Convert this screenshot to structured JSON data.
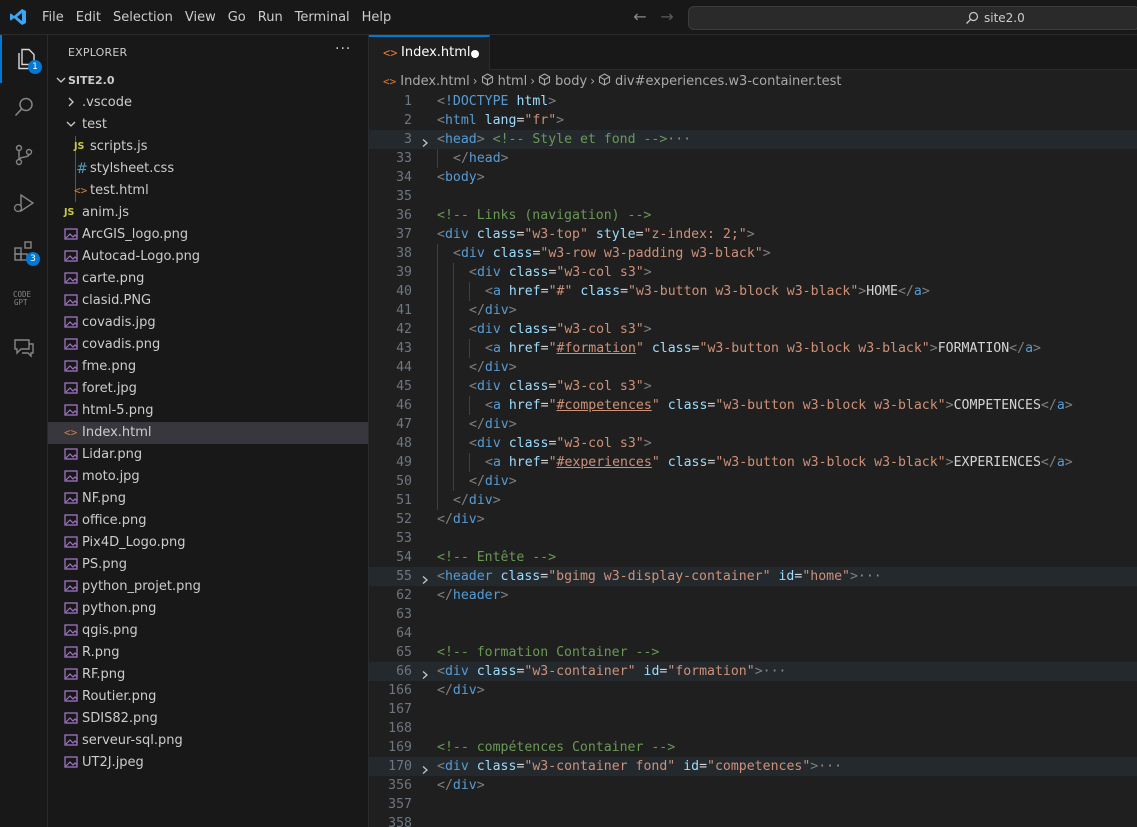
{
  "menu": [
    "File",
    "Edit",
    "Selection",
    "View",
    "Go",
    "Run",
    "Terminal",
    "Help"
  ],
  "command_center": {
    "label": "site2.0"
  },
  "activity_badges": {
    "explorer": "1",
    "extensions": "3"
  },
  "sidebar": {
    "title": "EXPLORER",
    "more": "···",
    "folder": "SITE2.0",
    "items": [
      {
        "label": ".vscode",
        "type": "folder-closed"
      },
      {
        "label": "test",
        "type": "folder-open"
      },
      {
        "label": "scripts.js",
        "type": "js"
      },
      {
        "label": "stylsheet.css",
        "type": "css"
      },
      {
        "label": "test.html",
        "type": "html"
      },
      {
        "label": "anim.js",
        "type": "js"
      },
      {
        "label": "ArcGIS_logo.png",
        "type": "image"
      },
      {
        "label": "Autocad-Logo.png",
        "type": "image"
      },
      {
        "label": "carte.png",
        "type": "image"
      },
      {
        "label": "clasid.PNG",
        "type": "image"
      },
      {
        "label": "covadis.jpg",
        "type": "image"
      },
      {
        "label": "covadis.png",
        "type": "image"
      },
      {
        "label": "fme.png",
        "type": "image"
      },
      {
        "label": "foret.jpg",
        "type": "image"
      },
      {
        "label": "html-5.png",
        "type": "image"
      },
      {
        "label": "Index.html",
        "type": "html"
      },
      {
        "label": "Lidar.png",
        "type": "image"
      },
      {
        "label": "moto.jpg",
        "type": "image"
      },
      {
        "label": "NF.png",
        "type": "image"
      },
      {
        "label": "office.png",
        "type": "image"
      },
      {
        "label": "Pix4D_Logo.png",
        "type": "image"
      },
      {
        "label": "PS.png",
        "type": "image"
      },
      {
        "label": "python_projet.png",
        "type": "image"
      },
      {
        "label": "python.png",
        "type": "image"
      },
      {
        "label": "qgis.png",
        "type": "image"
      },
      {
        "label": "R.png",
        "type": "image"
      },
      {
        "label": "RF.png",
        "type": "image"
      },
      {
        "label": "Routier.png",
        "type": "image"
      },
      {
        "label": "SDIS82.png",
        "type": "image"
      },
      {
        "label": "serveur-sql.png",
        "type": "image"
      },
      {
        "label": "UT2J.jpeg",
        "type": "image"
      }
    ]
  },
  "editor": {
    "tab": {
      "label": "Index.html"
    },
    "breadcrumbs": [
      "Index.html",
      "html",
      "body",
      "div#experiences.w3-container.test"
    ],
    "lines": [
      {
        "n": "1",
        "indent": 0,
        "tokens": [
          [
            "t",
            "<"
          ],
          [
            "tn",
            "!DOCTYPE"
          ],
          [
            "tx",
            " "
          ],
          [
            "an",
            "html"
          ],
          [
            "t",
            ">"
          ]
        ]
      },
      {
        "n": "2",
        "indent": 0,
        "tokens": [
          [
            "t",
            "<"
          ],
          [
            "tn",
            "html"
          ],
          [
            "tx",
            " "
          ],
          [
            "an",
            "lang"
          ],
          [
            "tx",
            "="
          ],
          [
            "av",
            "\"fr\""
          ],
          [
            "t",
            ">"
          ]
        ]
      },
      {
        "n": "3",
        "indent": 0,
        "fold": true,
        "hl": true,
        "tokens": [
          [
            "t",
            "<"
          ],
          [
            "tn",
            "head"
          ],
          [
            "t",
            ">"
          ],
          [
            "tx",
            " "
          ],
          [
            "cm",
            "<!-- Style et fond -->"
          ],
          [
            "ell",
            "···"
          ]
        ]
      },
      {
        "n": "33",
        "indent": 1,
        "tokens": [
          [
            "t",
            "</"
          ],
          [
            "tn",
            "head"
          ],
          [
            "t",
            ">"
          ]
        ]
      },
      {
        "n": "34",
        "indent": 0,
        "tokens": [
          [
            "t",
            "<"
          ],
          [
            "tn",
            "body"
          ],
          [
            "t",
            ">"
          ]
        ]
      },
      {
        "n": "35",
        "indent": 0,
        "tokens": []
      },
      {
        "n": "36",
        "indent": 0,
        "tokens": [
          [
            "cm",
            "<!-- Links (navigation) -->"
          ]
        ]
      },
      {
        "n": "37",
        "indent": 0,
        "tokens": [
          [
            "t",
            "<"
          ],
          [
            "tn",
            "div"
          ],
          [
            "tx",
            " "
          ],
          [
            "an",
            "class"
          ],
          [
            "tx",
            "="
          ],
          [
            "av",
            "\"w3-top\""
          ],
          [
            "tx",
            " "
          ],
          [
            "an",
            "style"
          ],
          [
            "tx",
            "="
          ],
          [
            "av",
            "\"z-index: 2;\""
          ],
          [
            "t",
            ">"
          ]
        ]
      },
      {
        "n": "38",
        "indent": 1,
        "tokens": [
          [
            "t",
            "<"
          ],
          [
            "tn",
            "div"
          ],
          [
            "tx",
            " "
          ],
          [
            "an",
            "class"
          ],
          [
            "tx",
            "="
          ],
          [
            "av",
            "\"w3-row w3-padding w3-black\""
          ],
          [
            "t",
            ">"
          ]
        ]
      },
      {
        "n": "39",
        "indent": 2,
        "tokens": [
          [
            "t",
            "<"
          ],
          [
            "tn",
            "div"
          ],
          [
            "tx",
            " "
          ],
          [
            "an",
            "class"
          ],
          [
            "tx",
            "="
          ],
          [
            "av",
            "\"w3-col s3\""
          ],
          [
            "t",
            ">"
          ]
        ]
      },
      {
        "n": "40",
        "indent": 3,
        "tokens": [
          [
            "t",
            "<"
          ],
          [
            "tn",
            "a"
          ],
          [
            "tx",
            " "
          ],
          [
            "an",
            "href"
          ],
          [
            "tx",
            "="
          ],
          [
            "av",
            "\"#\""
          ],
          [
            "tx",
            " "
          ],
          [
            "an",
            "class"
          ],
          [
            "tx",
            "="
          ],
          [
            "av",
            "\"w3-button w3-block w3-black\""
          ],
          [
            "t",
            ">"
          ],
          [
            "tx",
            "HOME"
          ],
          [
            "t",
            "</"
          ],
          [
            "tn",
            "a"
          ],
          [
            "t",
            ">"
          ]
        ]
      },
      {
        "n": "41",
        "indent": 2,
        "tokens": [
          [
            "t",
            "</"
          ],
          [
            "tn",
            "div"
          ],
          [
            "t",
            ">"
          ]
        ]
      },
      {
        "n": "42",
        "indent": 2,
        "tokens": [
          [
            "t",
            "<"
          ],
          [
            "tn",
            "div"
          ],
          [
            "tx",
            " "
          ],
          [
            "an",
            "class"
          ],
          [
            "tx",
            "="
          ],
          [
            "av",
            "\"w3-col s3\""
          ],
          [
            "t",
            ">"
          ]
        ]
      },
      {
        "n": "43",
        "indent": 3,
        "tokens": [
          [
            "t",
            "<"
          ],
          [
            "tn",
            "a"
          ],
          [
            "tx",
            " "
          ],
          [
            "an",
            "href"
          ],
          [
            "tx",
            "="
          ],
          [
            "av",
            "\""
          ],
          [
            "lnk",
            "#formation"
          ],
          [
            "av",
            "\""
          ],
          [
            "tx",
            " "
          ],
          [
            "an",
            "class"
          ],
          [
            "tx",
            "="
          ],
          [
            "av",
            "\"w3-button w3-block w3-black\""
          ],
          [
            "t",
            ">"
          ],
          [
            "tx",
            "FORMATION"
          ],
          [
            "t",
            "</"
          ],
          [
            "tn",
            "a"
          ],
          [
            "t",
            ">"
          ]
        ]
      },
      {
        "n": "44",
        "indent": 2,
        "tokens": [
          [
            "t",
            "</"
          ],
          [
            "tn",
            "div"
          ],
          [
            "t",
            ">"
          ]
        ]
      },
      {
        "n": "45",
        "indent": 2,
        "tokens": [
          [
            "t",
            "<"
          ],
          [
            "tn",
            "div"
          ],
          [
            "tx",
            " "
          ],
          [
            "an",
            "class"
          ],
          [
            "tx",
            "="
          ],
          [
            "av",
            "\"w3-col s3\""
          ],
          [
            "t",
            ">"
          ]
        ]
      },
      {
        "n": "46",
        "indent": 3,
        "tokens": [
          [
            "t",
            "<"
          ],
          [
            "tn",
            "a"
          ],
          [
            "tx",
            " "
          ],
          [
            "an",
            "href"
          ],
          [
            "tx",
            "="
          ],
          [
            "av",
            "\""
          ],
          [
            "lnk",
            "#competences"
          ],
          [
            "av",
            "\""
          ],
          [
            "tx",
            " "
          ],
          [
            "an",
            "class"
          ],
          [
            "tx",
            "="
          ],
          [
            "av",
            "\"w3-button w3-block w3-black\""
          ],
          [
            "t",
            ">"
          ],
          [
            "tx",
            "COMPETENCES"
          ],
          [
            "t",
            "</"
          ],
          [
            "tn",
            "a"
          ],
          [
            "t",
            ">"
          ]
        ]
      },
      {
        "n": "47",
        "indent": 2,
        "tokens": [
          [
            "t",
            "</"
          ],
          [
            "tn",
            "div"
          ],
          [
            "t",
            ">"
          ]
        ]
      },
      {
        "n": "48",
        "indent": 2,
        "tokens": [
          [
            "t",
            "<"
          ],
          [
            "tn",
            "div"
          ],
          [
            "tx",
            " "
          ],
          [
            "an",
            "class"
          ],
          [
            "tx",
            "="
          ],
          [
            "av",
            "\"w3-col s3\""
          ],
          [
            "t",
            ">"
          ]
        ]
      },
      {
        "n": "49",
        "indent": 3,
        "tokens": [
          [
            "t",
            "<"
          ],
          [
            "tn",
            "a"
          ],
          [
            "tx",
            " "
          ],
          [
            "an",
            "href"
          ],
          [
            "tx",
            "="
          ],
          [
            "av",
            "\""
          ],
          [
            "lnk",
            "#experiences"
          ],
          [
            "av",
            "\""
          ],
          [
            "tx",
            " "
          ],
          [
            "an",
            "class"
          ],
          [
            "tx",
            "="
          ],
          [
            "av",
            "\"w3-button w3-block w3-black\""
          ],
          [
            "t",
            ">"
          ],
          [
            "tx",
            "EXPERIENCES"
          ],
          [
            "t",
            "</"
          ],
          [
            "tn",
            "a"
          ],
          [
            "t",
            ">"
          ]
        ]
      },
      {
        "n": "50",
        "indent": 2,
        "tokens": [
          [
            "t",
            "</"
          ],
          [
            "tn",
            "div"
          ],
          [
            "t",
            ">"
          ]
        ]
      },
      {
        "n": "51",
        "indent": 1,
        "tokens": [
          [
            "t",
            "</"
          ],
          [
            "tn",
            "div"
          ],
          [
            "t",
            ">"
          ]
        ]
      },
      {
        "n": "52",
        "indent": 0,
        "tokens": [
          [
            "t",
            "</"
          ],
          [
            "tn",
            "div"
          ],
          [
            "t",
            ">"
          ]
        ]
      },
      {
        "n": "53",
        "indent": 0,
        "tokens": []
      },
      {
        "n": "54",
        "indent": 0,
        "tokens": [
          [
            "cm",
            "<!-- Entête -->"
          ]
        ]
      },
      {
        "n": "55",
        "indent": 0,
        "fold": true,
        "hl": true,
        "tokens": [
          [
            "t",
            "<"
          ],
          [
            "tn",
            "header"
          ],
          [
            "tx",
            " "
          ],
          [
            "an",
            "class"
          ],
          [
            "tx",
            "="
          ],
          [
            "av",
            "\"bgimg w3-display-container\""
          ],
          [
            "tx",
            " "
          ],
          [
            "an",
            "id"
          ],
          [
            "tx",
            "="
          ],
          [
            "av",
            "\"home\""
          ],
          [
            "t",
            ">"
          ],
          [
            "ell",
            "···"
          ]
        ]
      },
      {
        "n": "62",
        "indent": 0,
        "tokens": [
          [
            "t",
            "</"
          ],
          [
            "tn",
            "header"
          ],
          [
            "t",
            ">"
          ]
        ]
      },
      {
        "n": "63",
        "indent": 0,
        "tokens": []
      },
      {
        "n": "64",
        "indent": 0,
        "tokens": []
      },
      {
        "n": "65",
        "indent": 0,
        "tokens": [
          [
            "cm",
            "<!-- formation Container -->"
          ]
        ]
      },
      {
        "n": "66",
        "indent": 0,
        "fold": true,
        "hl": true,
        "tokens": [
          [
            "t",
            "<"
          ],
          [
            "tn",
            "div"
          ],
          [
            "tx",
            " "
          ],
          [
            "an",
            "class"
          ],
          [
            "tx",
            "="
          ],
          [
            "av",
            "\"w3-container\""
          ],
          [
            "tx",
            " "
          ],
          [
            "an",
            "id"
          ],
          [
            "tx",
            "="
          ],
          [
            "av",
            "\"formation\""
          ],
          [
            "t",
            ">"
          ],
          [
            "ell",
            "···"
          ]
        ]
      },
      {
        "n": "166",
        "indent": 0,
        "tokens": [
          [
            "t",
            "</"
          ],
          [
            "tn",
            "div"
          ],
          [
            "t",
            ">"
          ]
        ]
      },
      {
        "n": "167",
        "indent": 0,
        "tokens": []
      },
      {
        "n": "168",
        "indent": 0,
        "tokens": []
      },
      {
        "n": "169",
        "indent": 0,
        "tokens": [
          [
            "cm",
            "<!-- compétences Container -->"
          ]
        ]
      },
      {
        "n": "170",
        "indent": 0,
        "fold": true,
        "hl": true,
        "tokens": [
          [
            "t",
            "<"
          ],
          [
            "tn",
            "div"
          ],
          [
            "tx",
            " "
          ],
          [
            "an",
            "class"
          ],
          [
            "tx",
            "="
          ],
          [
            "av",
            "\"w3-container fond\""
          ],
          [
            "tx",
            " "
          ],
          [
            "an",
            "id"
          ],
          [
            "tx",
            "="
          ],
          [
            "av",
            "\"competences\""
          ],
          [
            "t",
            ">"
          ],
          [
            "ell",
            "···"
          ]
        ]
      },
      {
        "n": "356",
        "indent": 0,
        "tokens": [
          [
            "t",
            "</"
          ],
          [
            "tn",
            "div"
          ],
          [
            "t",
            ">"
          ]
        ]
      },
      {
        "n": "357",
        "indent": 0,
        "tokens": []
      },
      {
        "n": "358",
        "indent": 0,
        "tokens": []
      }
    ]
  }
}
